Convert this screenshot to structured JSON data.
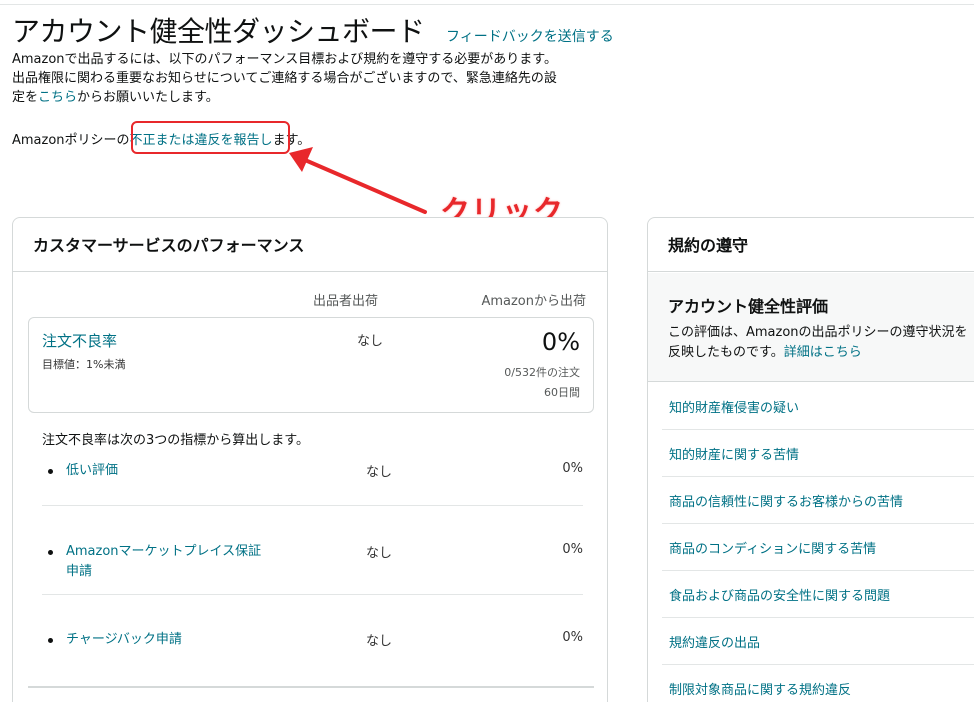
{
  "header": {
    "title": "アカウント健全性ダッシュボード",
    "feedback_link": "フィードバックを送信する"
  },
  "intro": {
    "line1": "Amazonで出品するには、以下のパフォーマンス目標および規約を遵守する必要があります。",
    "line2": "出品権限に関わる重要なお知らせについてご連絡する場合がございますので、緊急連絡先の設",
    "line3_prefix": "定を",
    "line3_link": "こちら",
    "line3_suffix": "からお願いいたします。"
  },
  "policy": {
    "prefix": "Amazonポリシーの",
    "link": "不正または違反を報告し",
    "suffix": "ます。"
  },
  "annotation": {
    "label": "クリック",
    "color": "#e8282b"
  },
  "customer_service": {
    "title": "カスタマーサービスのパフォーマンス",
    "col_seller": "出品者出荷",
    "col_amazon": "Amazonから出荷",
    "odr": {
      "title": "注文不良率",
      "target": "目標値：1%未満",
      "seller_value": "なし",
      "amazon_value": "0%",
      "orders": "0/532件の注文",
      "period": "60日間"
    },
    "calc_note": "注文不良率は次の3つの指標から算出します。",
    "sub_metrics": [
      {
        "label": "低い評価",
        "seller": "なし",
        "amazon": "0%"
      },
      {
        "label": "Amazonマーケットプレイス保証申請",
        "seller": "なし",
        "amazon": "0%"
      },
      {
        "label": "チャージバック申請",
        "seller": "なし",
        "amazon": "0%"
      }
    ]
  },
  "policy_compliance": {
    "title": "規約の遵守",
    "rating_title": "アカウント健全性評価",
    "rating_desc": "この評価は、Amazonの出品ポリシーの遵守状況を反映したものです。",
    "rating_link": "詳細はこちら",
    "items": [
      "知的財産権侵害の疑い",
      "知的財産に関する苦情",
      "商品の信頼性に関するお客様からの苦情",
      "商品のコンディションに関する苦情",
      "食品および商品の安全性に関する問題",
      "規約違反の出品",
      "制限対象商品に関する規約違反"
    ]
  }
}
